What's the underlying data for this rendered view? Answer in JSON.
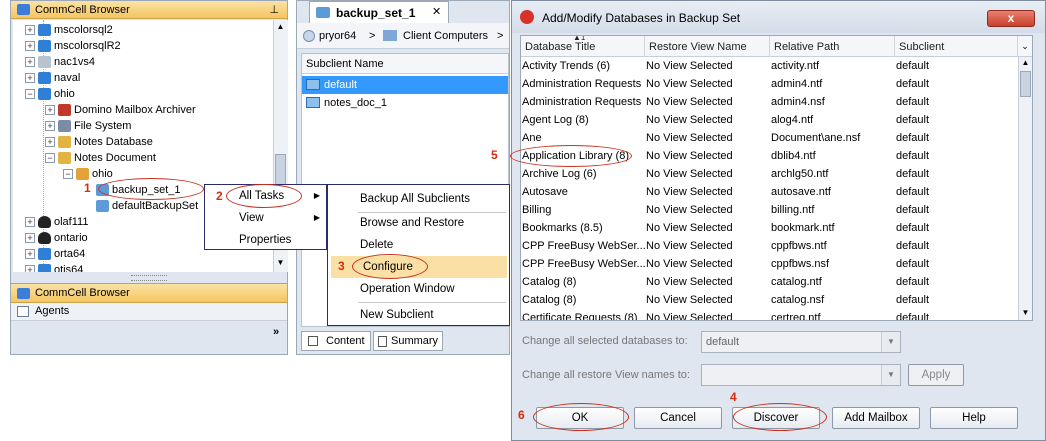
{
  "left": {
    "header_title": "CommCell Browser",
    "tree": [
      {
        "label": "mscolorsql2",
        "level": 1,
        "icon": "windows-icon"
      },
      {
        "label": "mscolorsqlR2",
        "level": 1,
        "icon": "windows-icon"
      },
      {
        "label": "nac1vs4",
        "level": 1,
        "icon": "server-icon"
      },
      {
        "label": "naval",
        "level": 1,
        "icon": "windows-icon"
      },
      {
        "label": "ohio",
        "level": 1,
        "icon": "windows-icon"
      },
      {
        "label": "Domino Mailbox Archiver",
        "level": 2,
        "icon": "domino-icon"
      },
      {
        "label": "File System",
        "level": 2,
        "icon": "filesystem-icon"
      },
      {
        "label": "Notes Database",
        "level": 2,
        "icon": "notes-icon"
      },
      {
        "label": "Notes Document",
        "level": 2,
        "icon": "notes-icon"
      },
      {
        "label": "ohio",
        "level": 3,
        "icon": "instance-icon"
      },
      {
        "label": "backup_set_1",
        "level": 4,
        "icon": "backupset-icon"
      },
      {
        "label": "defaultBackupSet",
        "level": 4,
        "icon": "backupset-icon"
      },
      {
        "label": "olaf111",
        "level": 1,
        "icon": "linux-icon"
      },
      {
        "label": "ontario",
        "level": 1,
        "icon": "linux-icon"
      },
      {
        "label": "orta64",
        "level": 1,
        "icon": "windows-icon"
      },
      {
        "label": "otis64",
        "level": 1,
        "icon": "windows-icon"
      }
    ],
    "bottom_tab_browser": "CommCell Browser",
    "bottom_tab_agents": "Agents"
  },
  "middle": {
    "tab_title": "backup_set_1",
    "breadcrumb_1": "pryor64",
    "breadcrumb_sep": ">",
    "breadcrumb_2": "Client Computers",
    "breadcrumb_3": ">",
    "column_header": "Subclient Name",
    "rows": [
      "default",
      "notes_doc_1"
    ],
    "tab_content": "Content",
    "tab_summary": "Summary"
  },
  "context_menu": {
    "items": [
      "All Tasks",
      "View",
      "Properties"
    ]
  },
  "submenu": {
    "items": [
      "Backup All Subclients",
      "Browse and Restore",
      "Delete",
      "Configure",
      "Operation Window",
      "New Subclient"
    ]
  },
  "dialog": {
    "title": "Add/Modify Databases in Backup Set",
    "sort_indicator": "1",
    "columns": [
      "Database Title",
      "Restore View Name",
      "Relative Path",
      "Subclient"
    ],
    "rows": [
      [
        "Activity Trends (6)",
        "No View Selected",
        "activity.ntf",
        "default"
      ],
      [
        "Administration Requests",
        "No View Selected",
        "admin4.ntf",
        "default"
      ],
      [
        "Administration Requests",
        "No View Selected",
        "admin4.nsf",
        "default"
      ],
      [
        "Agent Log (8)",
        "No View Selected",
        "alog4.ntf",
        "default"
      ],
      [
        "Ane",
        "No View Selected",
        "Document\\ane.nsf",
        "default"
      ],
      [
        "Application Library (8)",
        "No View Selected",
        "dblib4.ntf",
        "default"
      ],
      [
        "Archive Log (6)",
        "No View Selected",
        "archlg50.ntf",
        "default"
      ],
      [
        "Autosave",
        "No View Selected",
        "autosave.ntf",
        "default"
      ],
      [
        "Billing",
        "No View Selected",
        "billing.ntf",
        "default"
      ],
      [
        "Bookmarks (8.5)",
        "No View Selected",
        "bookmark.ntf",
        "default"
      ],
      [
        "CPP FreeBusy WebSer...",
        "No View Selected",
        "cppfbws.ntf",
        "default"
      ],
      [
        "CPP FreeBusy WebSer...",
        "No View Selected",
        "cppfbws.nsf",
        "default"
      ],
      [
        "Catalog (8)",
        "No View Selected",
        "catalog.ntf",
        "default"
      ],
      [
        "Catalog (8)",
        "No View Selected",
        "catalog.nsf",
        "default"
      ],
      [
        "Certificate Requests (8)",
        "No View Selected",
        "certreq.ntf",
        "default"
      ]
    ],
    "change_db_label": "Change all selected databases to:",
    "change_db_value": "default",
    "change_view_label": "Change all restore View names to:",
    "change_view_value": "",
    "apply_label": "Apply",
    "buttons": {
      "ok": "OK",
      "cancel": "Cancel",
      "discover": "Discover",
      "add_mailbox": "Add Mailbox",
      "help": "Help"
    },
    "close_glyph": "x"
  },
  "annotations": {
    "n1": "1",
    "n2": "2",
    "n3": "3",
    "n4": "4",
    "n5": "5",
    "n6": "6"
  },
  "colors": {
    "selection": "#3399ff",
    "highlight_menu": "#fbe0a6",
    "annotation": "#d82b10"
  }
}
